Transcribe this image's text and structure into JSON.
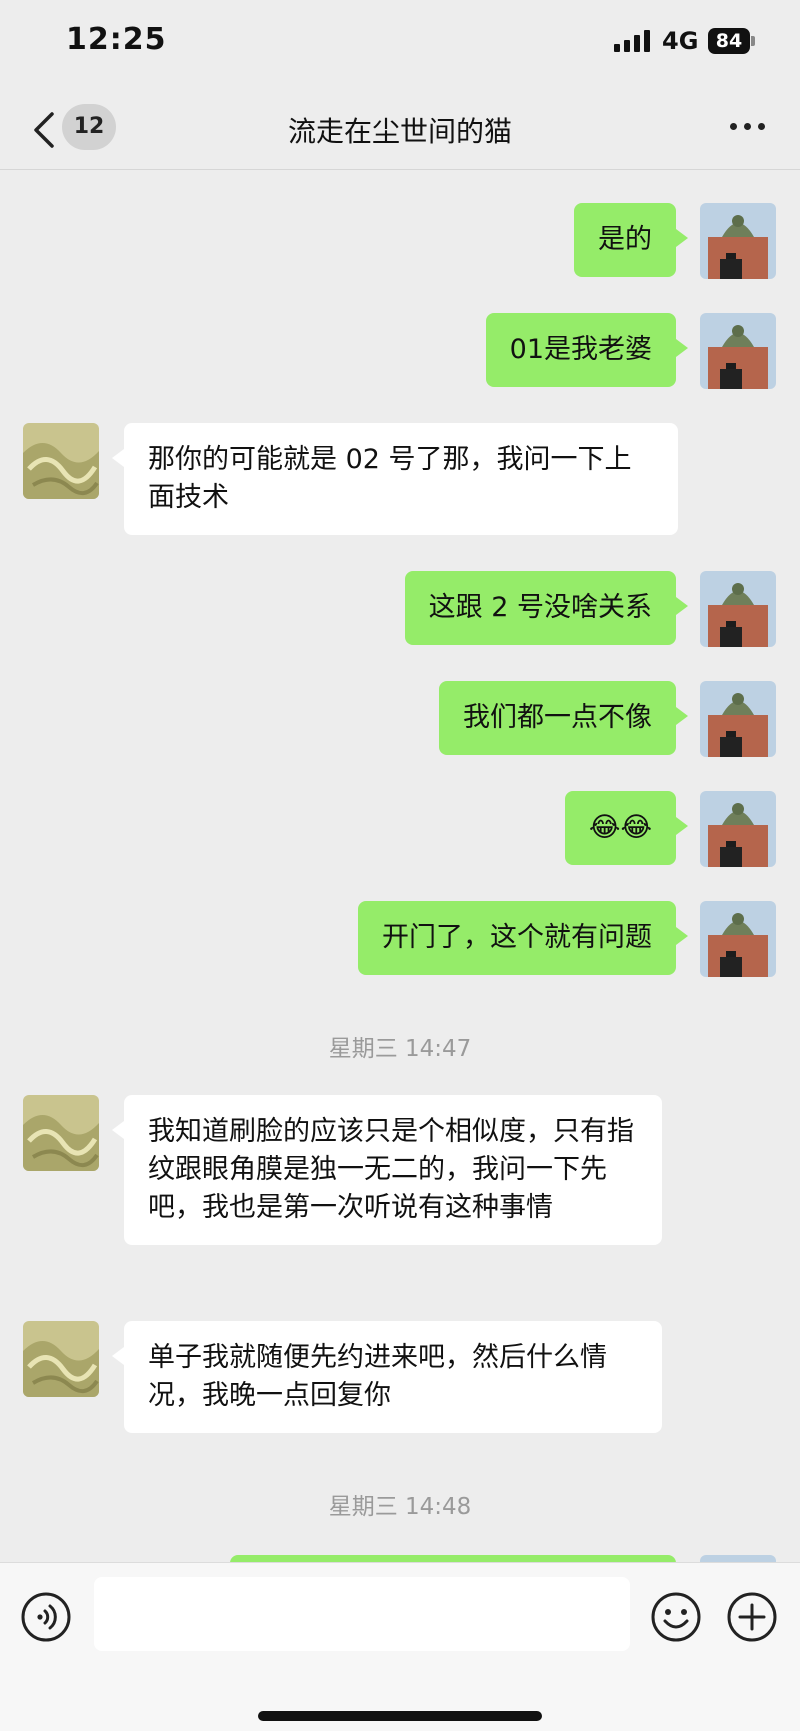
{
  "status_bar": {
    "time": "12:25",
    "network": "4G",
    "battery": "84"
  },
  "nav": {
    "unread_count": "12",
    "title": "流走在尘世间的猫"
  },
  "messages": [
    {
      "from": "me",
      "text": "是的"
    },
    {
      "from": "me",
      "text": "01是我老婆"
    },
    {
      "from": "other",
      "text": "那你的可能就是 02 号了那，我问一下上面技术"
    },
    {
      "from": "me",
      "text": "这跟 2 号没啥关系"
    },
    {
      "from": "me",
      "text": "我们都一点不像"
    },
    {
      "from": "me",
      "text": "😂😂"
    },
    {
      "from": "me",
      "text": "开门了，这个就有问题"
    },
    {
      "from": "other",
      "text": "我知道刷脸的应该只是个相似度，只有指纹跟眼角膜是独一无二的，我问一下先吧，我也是第一次听说有这种事情"
    },
    {
      "from": "other",
      "text": "单子我就随便先约进来吧，然后什么情况，我晚一点回复你"
    }
  ],
  "timestamps": [
    "星期三 14:47",
    "星期三 14:48"
  ],
  "colors": {
    "my_bubble": "#95ec69",
    "other_bubble": "#ffffff",
    "background": "#ededed"
  },
  "input": {
    "value": "",
    "placeholder": ""
  },
  "icons": [
    "back-icon",
    "more-icon",
    "voice-icon",
    "emoji-icon",
    "plus-icon"
  ]
}
